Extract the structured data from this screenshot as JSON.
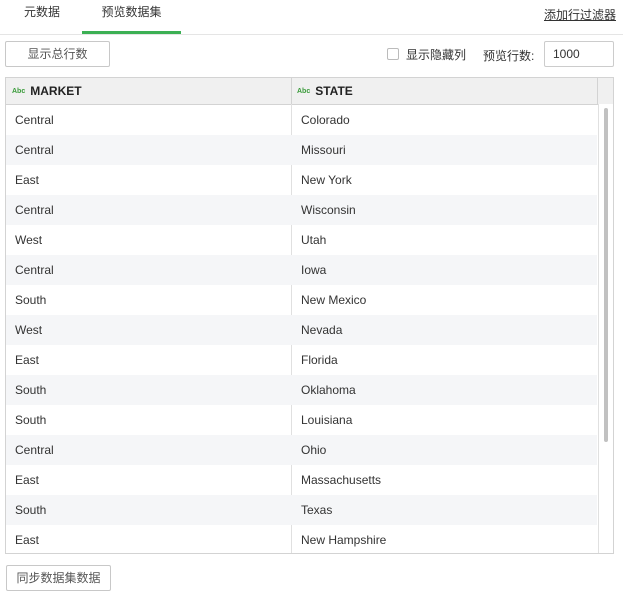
{
  "tabs": [
    {
      "label": "元数据"
    },
    {
      "label": "预览数据集"
    }
  ],
  "add_filter_label": "添加行过滤器",
  "toolbar": {
    "show_total_label": "显示总行数",
    "show_hidden_label": "显示隐藏列",
    "preview_rows_label": "预览行数:",
    "preview_rows_value": "1000"
  },
  "columns": [
    {
      "type_icon": "Abc",
      "name": "MARKET"
    },
    {
      "type_icon": "Abc",
      "name": "STATE"
    }
  ],
  "rows": [
    [
      "Central",
      "Colorado"
    ],
    [
      "Central",
      "Missouri"
    ],
    [
      "East",
      "New York"
    ],
    [
      "Central",
      "Wisconsin"
    ],
    [
      "West",
      "Utah"
    ],
    [
      "Central",
      "Iowa"
    ],
    [
      "South",
      "New Mexico"
    ],
    [
      "West",
      "Nevada"
    ],
    [
      "East",
      "Florida"
    ],
    [
      "South",
      "Oklahoma"
    ],
    [
      "South",
      "Louisiana"
    ],
    [
      "Central",
      "Ohio"
    ],
    [
      "East",
      "Massachusetts"
    ],
    [
      "South",
      "Texas"
    ],
    [
      "East",
      "New Hampshire"
    ]
  ],
  "sync_button_label": "同步数据集数据",
  "colors": {
    "accent": "#3cb054",
    "type_icon": "#3a9b3a"
  }
}
